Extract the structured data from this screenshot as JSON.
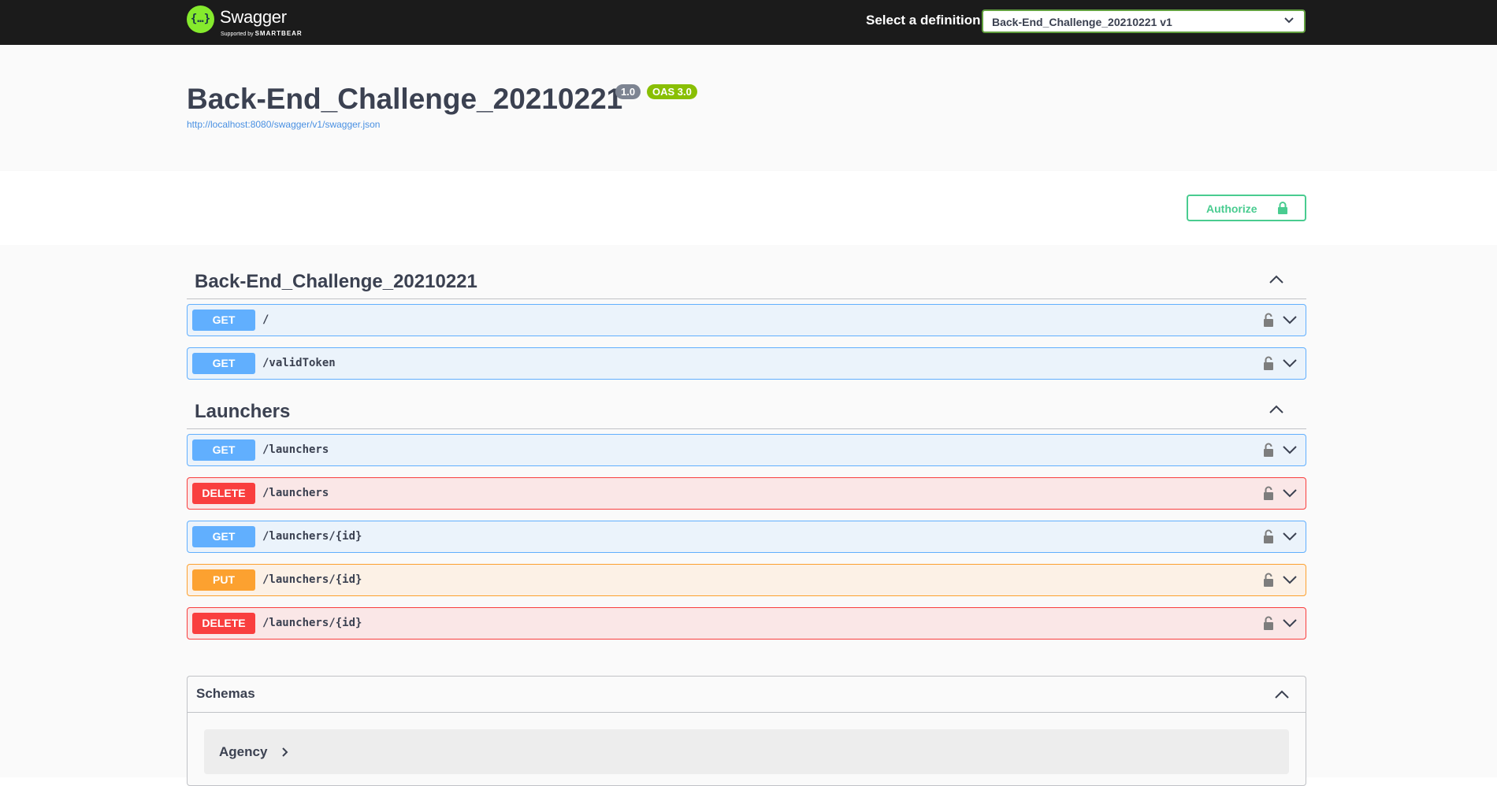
{
  "topbar": {
    "logo_glyph": "{…}",
    "logo_name": "Swagger",
    "logo_sub_prefix": "Supported by ",
    "logo_sub_brand": "SMARTBEAR",
    "select_label": "Select a definition",
    "selected_definition": "Back-End_Challenge_20210221 v1"
  },
  "info": {
    "title": "Back-End_Challenge_20210221",
    "version": "1.0",
    "oas": "OAS 3.0",
    "spec_url": "http://localhost:8080/swagger/v1/swagger.json"
  },
  "authorize": {
    "label": "Authorize"
  },
  "tags": [
    {
      "name": "Back-End_Challenge_20210221",
      "operations": [
        {
          "method": "GET",
          "path": "/"
        },
        {
          "method": "GET",
          "path": "/validToken"
        }
      ]
    },
    {
      "name": "Launchers",
      "operations": [
        {
          "method": "GET",
          "path": "/launchers"
        },
        {
          "method": "DELETE",
          "path": "/launchers"
        },
        {
          "method": "GET",
          "path": "/launchers/{id}"
        },
        {
          "method": "PUT",
          "path": "/launchers/{id}"
        },
        {
          "method": "DELETE",
          "path": "/launchers/{id}"
        }
      ]
    }
  ],
  "schemas": {
    "title": "Schemas",
    "models": [
      {
        "name": "Agency"
      }
    ]
  },
  "colors": {
    "get": "#61affe",
    "delete": "#f93e3e",
    "put": "#fca130",
    "authorize": "#49cc90",
    "oas_badge": "#89bf04",
    "topbar": "#1b1b1b"
  },
  "icons": {
    "lock": "lock-icon",
    "chevron_down": "chevron-down-icon",
    "chevron_up": "chevron-up-icon",
    "chevron_right": "chevron-right-icon",
    "logo": "swagger-logo-icon"
  }
}
